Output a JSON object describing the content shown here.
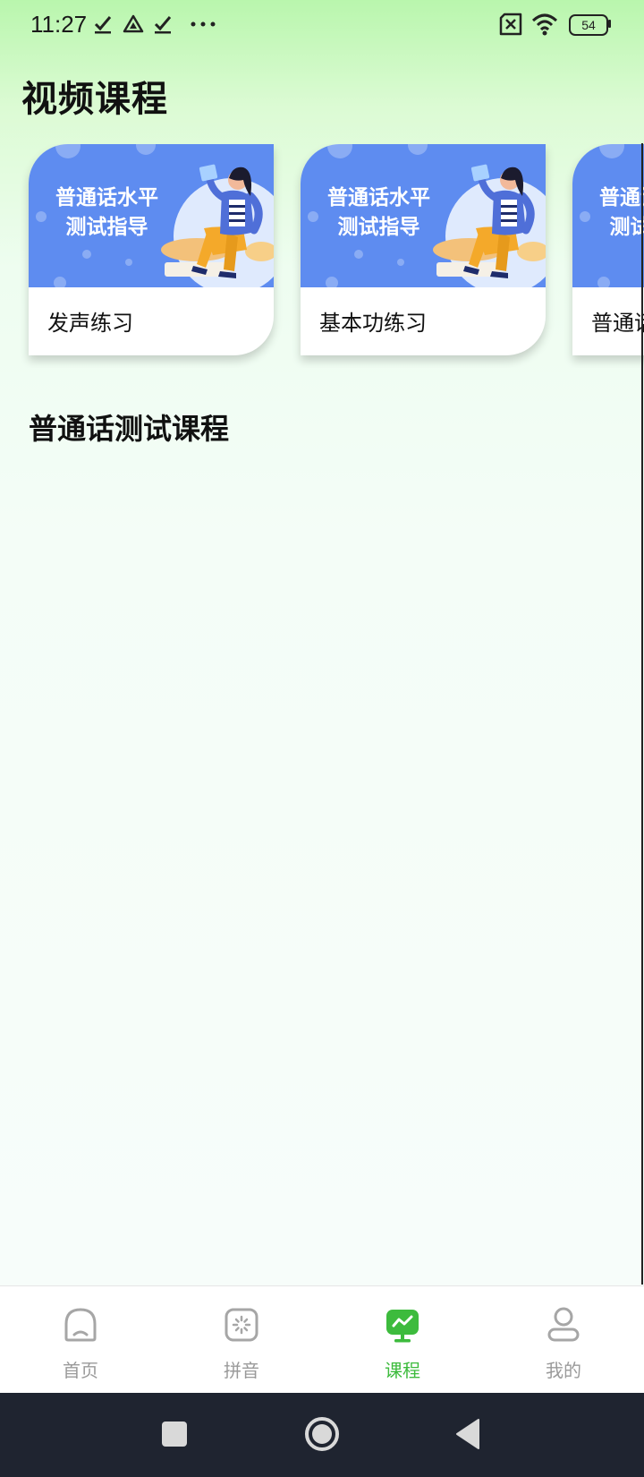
{
  "status_bar": {
    "time": "11:27",
    "battery": "54"
  },
  "page_title": "视频课程",
  "courses": [
    {
      "thumb_lines": [
        "普通话水平",
        "测试指导"
      ],
      "label": "发声练习"
    },
    {
      "thumb_lines": [
        "普通话水平",
        "测试指导"
      ],
      "label": "基本功练习"
    },
    {
      "thumb_lines": [
        "普通话水平",
        "测试指导"
      ],
      "label": "普通话"
    }
  ],
  "section_title": "普通话测试课程",
  "bottom_nav": {
    "active_color": "#3dbb3d",
    "inactive_color": "#9a9a9a",
    "items": [
      {
        "label": "首页",
        "icon": "home-icon",
        "active": false
      },
      {
        "label": "拼音",
        "icon": "pinyin-icon",
        "active": false
      },
      {
        "label": "课程",
        "icon": "course-icon",
        "active": true
      },
      {
        "label": "我的",
        "icon": "profile-icon",
        "active": false
      }
    ]
  },
  "colors": {
    "thumb_blue": "#5e8cf0",
    "accent_green": "#3dbb3d"
  }
}
